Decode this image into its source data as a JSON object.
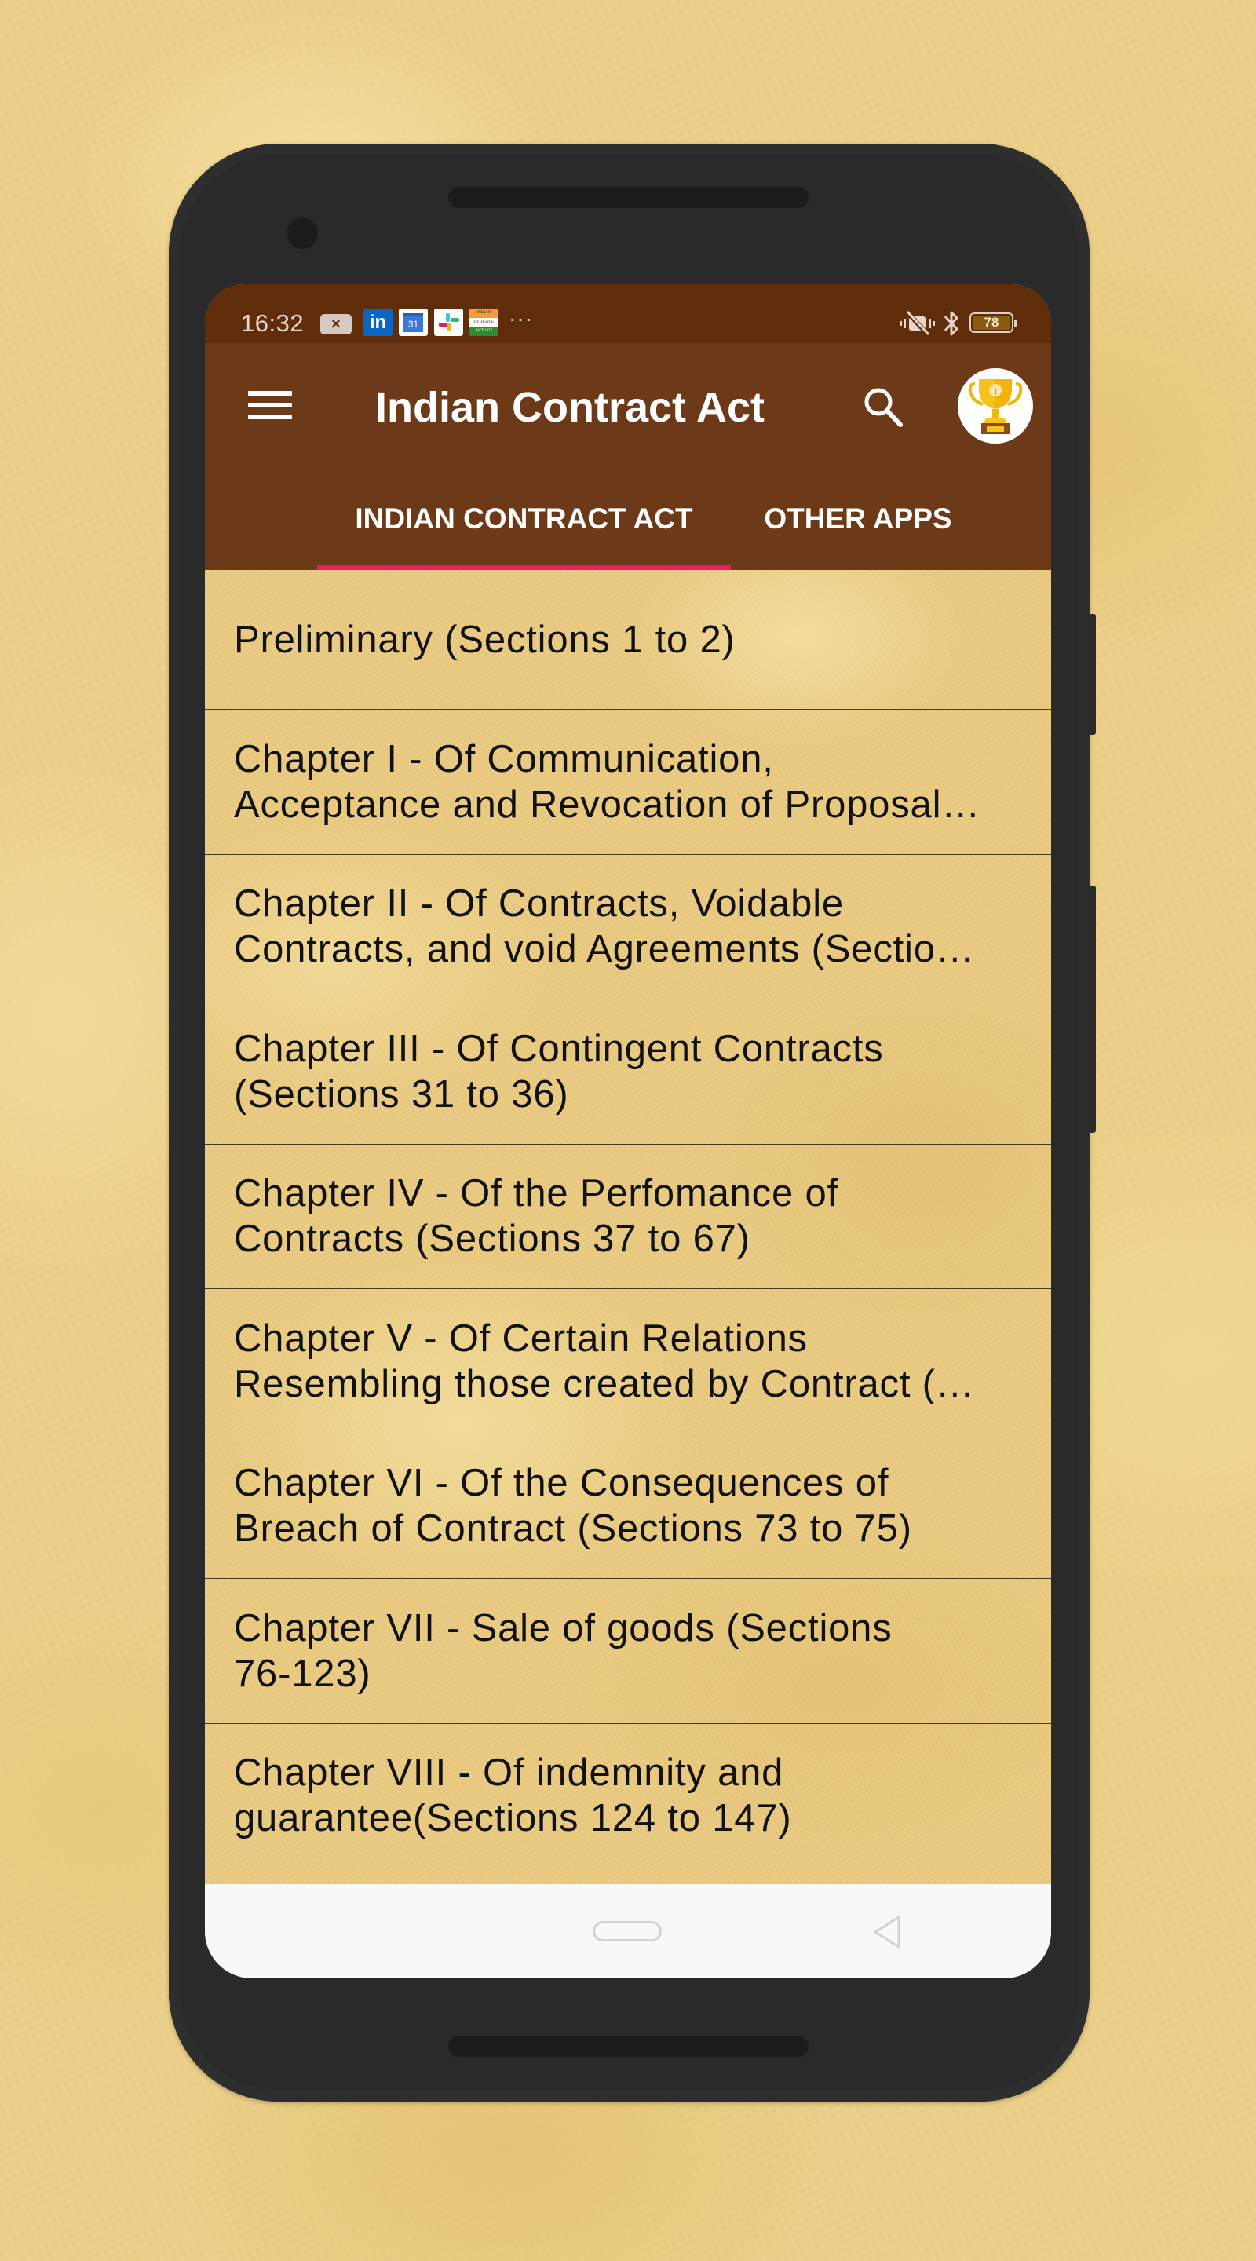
{
  "colors": {
    "status_bar": "#602d0b",
    "app_bar": "#6d3a19",
    "tab_indicator": "#e91e63",
    "item_text": "#111111",
    "divider": "#4a3a1e",
    "nav_bar": "#f8f8f8"
  },
  "status_bar": {
    "time": "16:32",
    "notification_icons": [
      "close-notification-icon",
      "linkedin-icon",
      "google-calendar-icon",
      "slack-icon",
      "indian-evidence-act-icon"
    ],
    "close_glyph": "×",
    "linkedin_label": "in",
    "calendar_day": "31",
    "indian_app_lines": [
      "INDIAN",
      "EVIDENCE",
      "ACT 1872"
    ],
    "overflow": "···",
    "system_icons": [
      "vibrate-off-icon",
      "bluetooth-icon",
      "battery-icon"
    ],
    "battery_level": "78"
  },
  "app_bar": {
    "menu_icon": "hamburger-menu-icon",
    "title": "Indian Contract Act",
    "search_icon": "search-icon",
    "trophy_icon": "trophy-icon",
    "trophy_rank": "1"
  },
  "tabs": [
    {
      "label": "INDIAN CONTRACT ACT",
      "selected": true
    },
    {
      "label": "OTHER APPS",
      "selected": false
    }
  ],
  "chapters": [
    {
      "lines": [
        "Preliminary (Sections 1 to 2)"
      ]
    },
    {
      "lines": [
        "Chapter I - Of Communication,",
        "Acceptance and Revocation of Proposal…"
      ]
    },
    {
      "lines": [
        "Chapter II - Of Contracts, Voidable",
        "Contracts, and void Agreements (Sectio…"
      ]
    },
    {
      "lines": [
        "Chapter III - Of Contingent Contracts",
        "(Sections 31 to 36)"
      ]
    },
    {
      "lines": [
        "Chapter IV - Of the Perfomance of",
        "Contracts (Sections 37 to 67)"
      ]
    },
    {
      "lines": [
        "Chapter V - Of Certain Relations",
        "Resembling those created by Contract (…"
      ]
    },
    {
      "lines": [
        "Chapter VI - Of the Consequences of",
        "Breach of Contract (Sections 73 to 75)"
      ]
    },
    {
      "lines": [
        "Chapter VII - Sale of goods (Sections",
        "76-123)"
      ]
    },
    {
      "lines": [
        "Chapter VIII - Of indemnity and",
        "guarantee(Sections 124 to 147)"
      ]
    }
  ],
  "nav_bar": {
    "buttons": [
      "home-button",
      "back-button"
    ]
  }
}
